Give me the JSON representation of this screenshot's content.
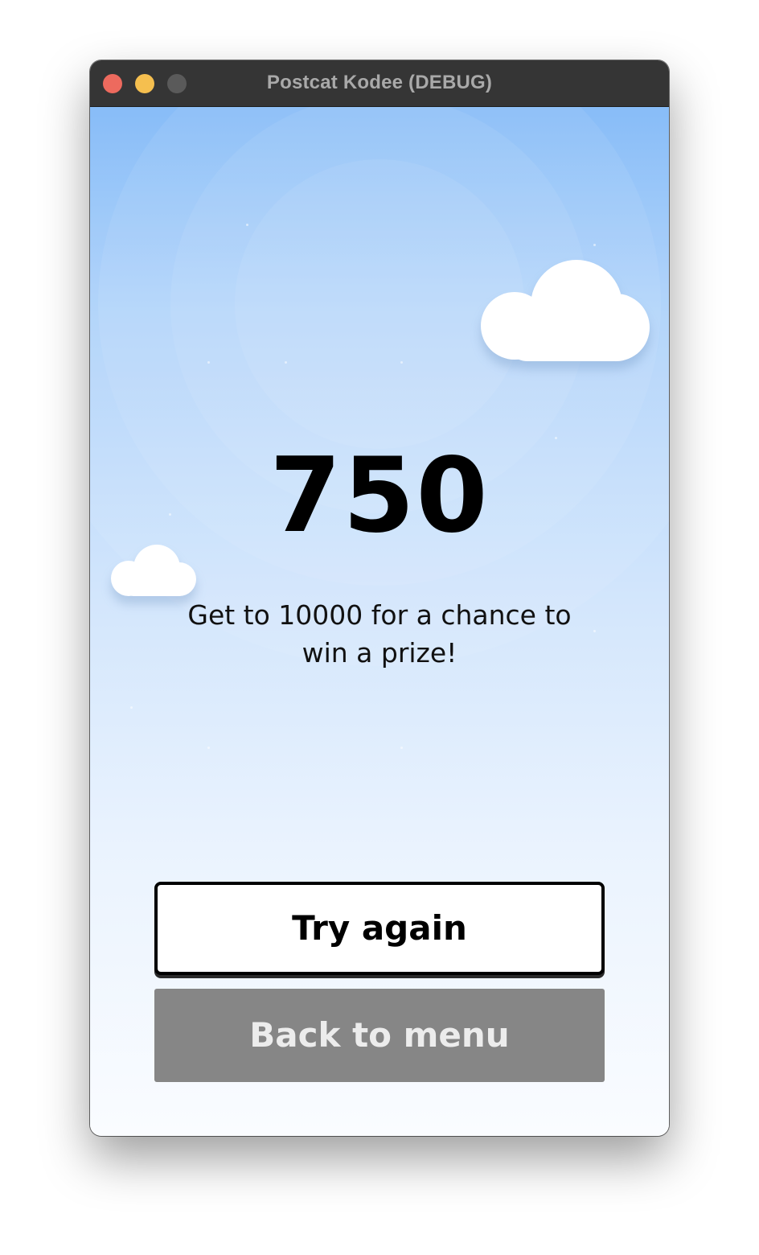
{
  "window": {
    "title": "Postcat Kodee (DEBUG)"
  },
  "game_over": {
    "score": "750",
    "message": "Get to 10000 for a chance to win a prize!",
    "try_again_label": "Try again",
    "back_to_menu_label": "Back to menu"
  },
  "colors": {
    "sky_top": "#7fb8f8",
    "sky_bottom": "#fafcff",
    "titlebar": "#353535",
    "close": "#ed6a5e",
    "minimize": "#f5bf4f",
    "maximize": "#5a5a5a",
    "back_button": "#868686"
  },
  "icons": [
    "close-window-icon",
    "minimize-window-icon",
    "maximize-window-icon",
    "cloud-icon"
  ]
}
